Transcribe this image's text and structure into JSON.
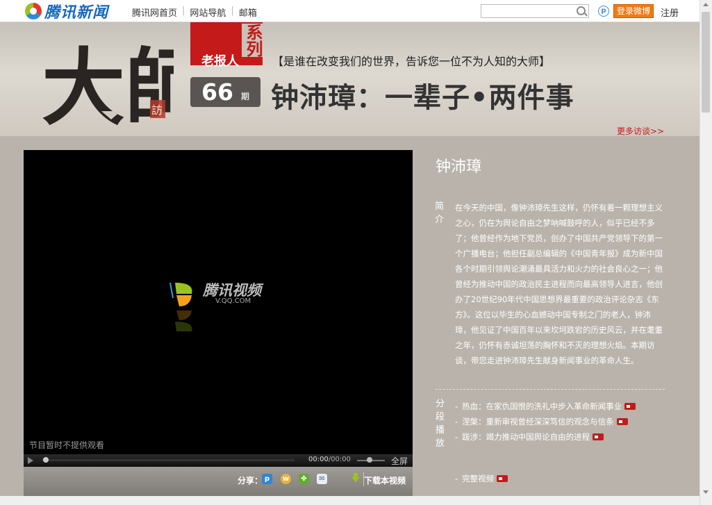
{
  "header": {
    "logo_text": "腾讯新闻",
    "nav": [
      "腾讯网首页",
      "网站导航",
      "邮箱"
    ],
    "search_placeholder": "",
    "login_label": "登录微博",
    "register_label": "注册"
  },
  "banner": {
    "art_title": "大師",
    "art_seal": "訪",
    "series_label": "老报人",
    "series_vertical": "系列",
    "subtitle": "【是谁在改变我们的世界，告诉您一位不为人知的大师】",
    "issue_number": "66",
    "issue_unit": "期",
    "main_title": "钟沛璋：一辈子•两件事",
    "more_link": "更多访谈>>"
  },
  "player": {
    "brand": "腾讯视频",
    "brand_url": "V.QQ.COM",
    "notice": "节目暂时不提供观看",
    "time_current": "00:00",
    "time_total": "/00:00",
    "fullscreen": "全屏",
    "share_label": "分享：",
    "download_label": "下载本视频"
  },
  "info": {
    "name": "钟沛璋",
    "intro_label": "简介",
    "intro": "在今天的中国，像钟沛璋先生这样，仍怀有着一颗理想主义之心，仍在为舆论自由之梦呐喊鼓呼的人，似乎已经不多了；他曾经作为地下党员，创办了中国共产党领导下的第一个广播电台；他担任副总编辑的《中国青年报》成为新中国各个时期引领舆论潮涌最具活力和火力的社会良心之一；他曾经为推动中国的政治民主进程而向最高领导人进言，他创办了20世纪90年代中国思想界最重要的政治评论杂志《东方》。这位以毕生的心血撼动中国专制之门的老人，钟沛璋，他见证了中国百年以来坎坷跌宕的历史风云，并在耄耋之年，仍怀有赤诚坦荡的胸怀和不灭的理想火焰。本期访谈，带您走进钟沛璋先生献身新闻事业的革命人生。",
    "segments_label": "分段播放",
    "segments": [
      "热血：在家仇国恨的洗礼中步入革命新闻事业",
      "涅槃：重新审视曾经深深笃信的观念与信条",
      "跋涉：竭力推动中国舆论自由的进程"
    ],
    "full_video": "完整视频"
  },
  "colors": {
    "accent": "#c41a1a",
    "login": "#f07a14",
    "link": "#1768c2"
  }
}
